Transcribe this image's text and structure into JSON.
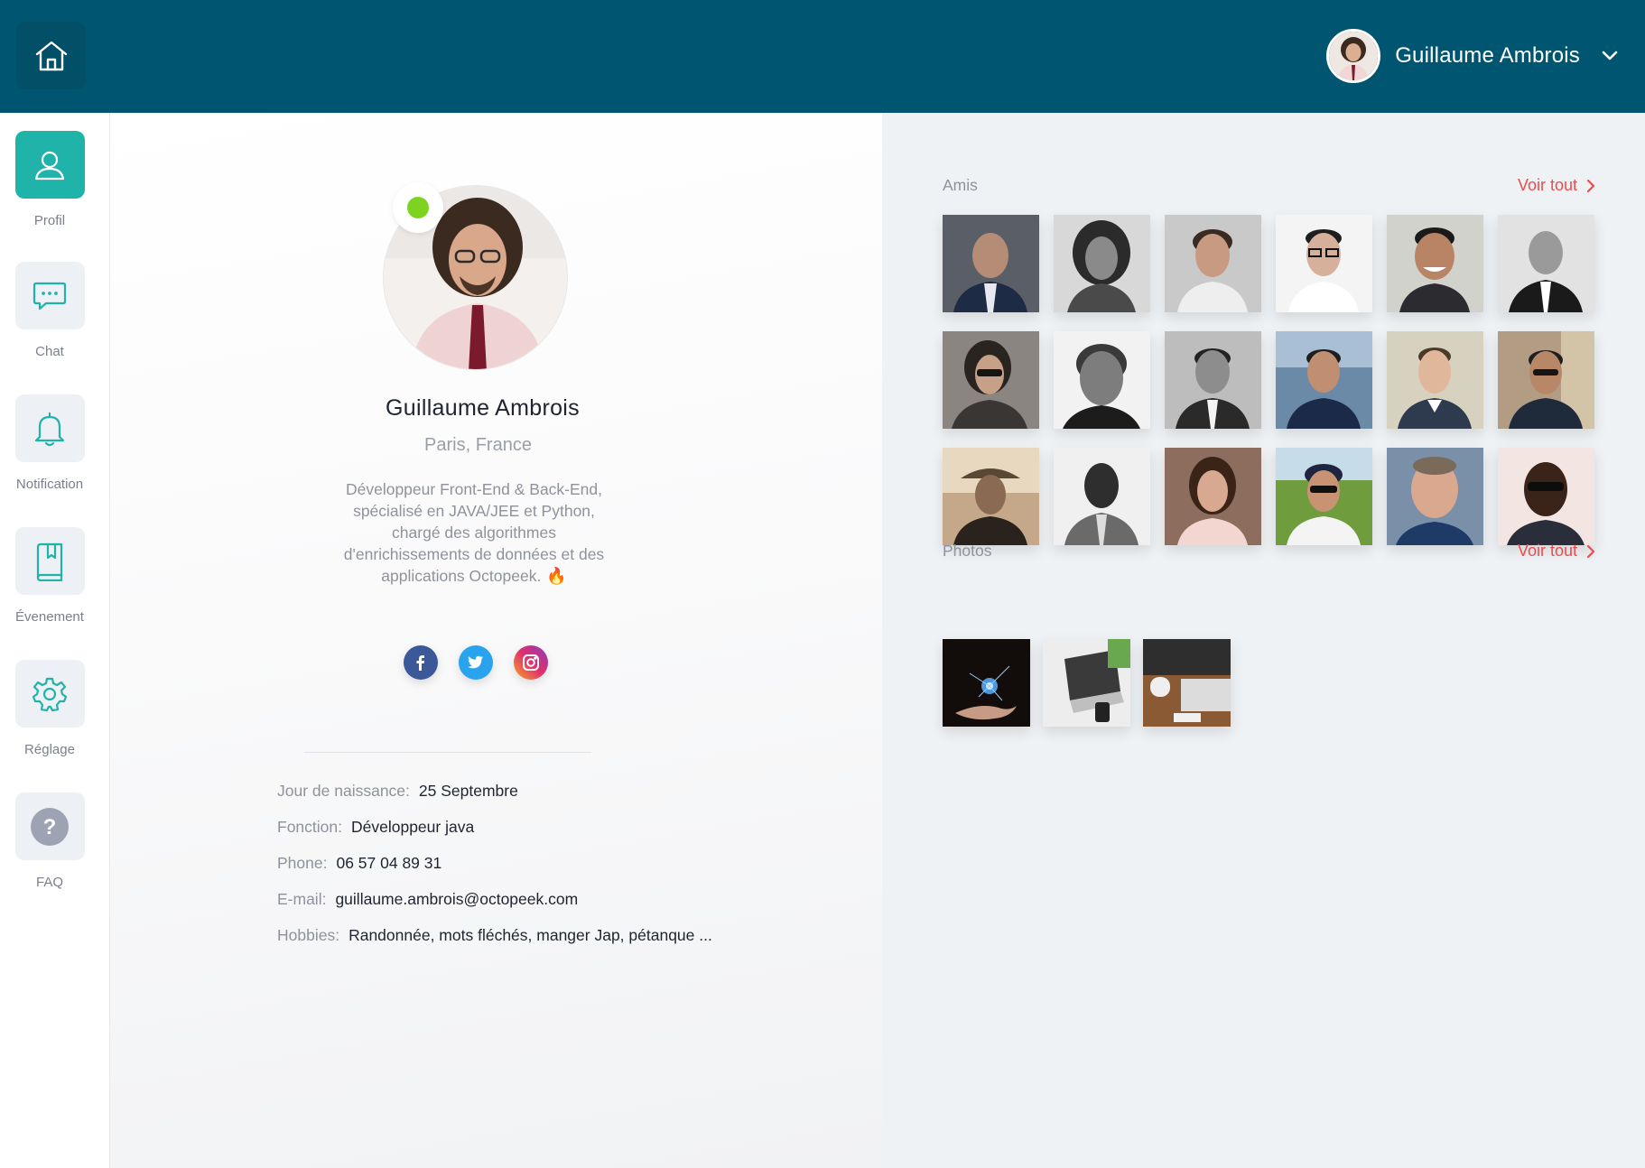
{
  "header": {
    "user_name": "Guillaume Ambrois"
  },
  "sidebar": {
    "items": [
      {
        "label": "Profil",
        "icon": "user-icon",
        "active": true
      },
      {
        "label": "Chat",
        "icon": "chat-icon",
        "active": false
      },
      {
        "label": "Notification",
        "icon": "bell-icon",
        "active": false
      },
      {
        "label": "Évenement",
        "icon": "bookmark-book-icon",
        "active": false
      },
      {
        "label": "Réglage",
        "icon": "gear-icon",
        "active": false
      },
      {
        "label": "FAQ",
        "icon": "question-icon",
        "active": false
      }
    ]
  },
  "profile": {
    "name": "Guillaume Ambrois",
    "location": "Paris, France",
    "bio_lines": [
      "Développeur Front-End & Back-End,",
      "spécialisé en JAVA/JEE et Python,",
      "chargé des algorithmes",
      "d'enrichissements de données et des",
      "applications Octopeek."
    ],
    "bio_emoji": "🔥",
    "status": "online",
    "status_color": "#7ed321",
    "socials": [
      "facebook-icon",
      "twitter-icon",
      "instagram-icon"
    ],
    "details": [
      {
        "label": "Jour de naissance:",
        "value": "25 Septembre"
      },
      {
        "label": "Fonction:",
        "value": "Développeur java"
      },
      {
        "label": "Phone:",
        "value": "06 57 04 89 31"
      },
      {
        "label": "E-mail:",
        "value": "guillaume.ambrois@octopeek.com"
      },
      {
        "label": "Hobbies:",
        "value": "Randonnée, mots fléchés, manger Jap, pétanque ..."
      }
    ]
  },
  "friends": {
    "title": "Amis",
    "see_all": "Voir tout",
    "count": 18
  },
  "photos": {
    "title": "Photos",
    "see_all": "Voir tout",
    "count": 3
  },
  "colors": {
    "header": "#005570",
    "accent": "#1fb3a9",
    "link": "#ef4b4b",
    "panel": "#eff2f5"
  }
}
